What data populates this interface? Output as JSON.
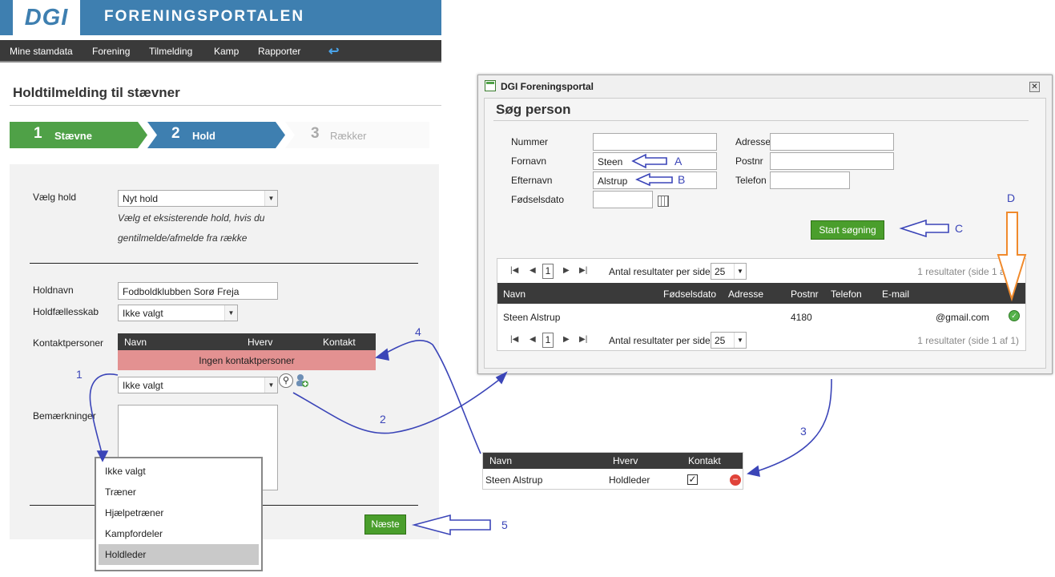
{
  "header": {
    "logo": "DGI",
    "title": "FORENINGSPORTALEN"
  },
  "nav": {
    "items": [
      "Mine stamdata",
      "Forening",
      "Tilmelding",
      "Kamp",
      "Rapporter"
    ],
    "back_icon": "undo-arrow-icon"
  },
  "page": {
    "title": "Holdtilmelding til stævner"
  },
  "steps": [
    {
      "num": "1",
      "label": "Stævne"
    },
    {
      "num": "2",
      "label": "Hold"
    },
    {
      "num": "3",
      "label": "Rækker"
    }
  ],
  "form": {
    "vaelg_hold_label": "Vælg hold",
    "vaelg_hold_value": "Nyt hold",
    "hint_line1": "Vælg et eksisterende hold, hvis du",
    "hint_line2": "gentilmelde/afmelde fra række",
    "holdnavn_label": "Holdnavn",
    "holdnavn_value": "Fodboldklubben Sorø Freja",
    "holdfaellesskab_label": "Holdfællesskab",
    "holdfaellesskab_value": "Ikke valgt",
    "kontakt_label": "Kontaktpersoner",
    "contact_table": {
      "headers": [
        "Navn",
        "Hverv",
        "Kontakt"
      ],
      "empty_text": "Ingen kontaktpersoner"
    },
    "role_select_value": "Ikke valgt",
    "bemaerkninger_label": "Bemærkninger",
    "next_button": "Næste"
  },
  "dropdown": {
    "options": [
      "Ikke valgt",
      "Træner",
      "Hjælpetræner",
      "Kampfordeler",
      "Holdleder"
    ],
    "selected": "Holdleder"
  },
  "dialog": {
    "title": "DGI Foreningsportal",
    "heading": "Søg person",
    "fields": {
      "nummer": {
        "label": "Nummer",
        "value": ""
      },
      "fornavn": {
        "label": "Fornavn",
        "value": "Steen"
      },
      "efternavn": {
        "label": "Efternavn",
        "value": "Alstrup"
      },
      "foedselsdato": {
        "label": "Fødselsdato",
        "value": ""
      },
      "adresse": {
        "label": "Adresse",
        "value": ""
      },
      "postnr": {
        "label": "Postnr",
        "value": ""
      },
      "telefon": {
        "label": "Telefon",
        "value": ""
      }
    },
    "search_button": "Start søgning",
    "pager": {
      "page": "1",
      "per_page_label": "Antal resultater per side",
      "per_page": "25",
      "info": "1 resultater (side 1 af 1)"
    },
    "results": {
      "headers": [
        "Navn",
        "Fødselsdato",
        "Adresse",
        "Postnr",
        "Telefon",
        "E-mail"
      ],
      "rows": [
        {
          "navn": "Steen Alstrup",
          "foedselsdato": "",
          "adresse": "",
          "postnr": "4180",
          "telefon": "",
          "email": "@gmail.com"
        }
      ]
    }
  },
  "result_table": {
    "headers": [
      "Navn",
      "Hverv",
      "Kontakt"
    ],
    "row": {
      "navn": "Steen Alstrup",
      "hverv": "Holdleder",
      "kontakt_checked": "✓"
    }
  },
  "annotations": {
    "A": "A",
    "B": "B",
    "C": "C",
    "D": "D",
    "n1": "1",
    "n2": "2",
    "n3": "3",
    "n4": "4",
    "n5": "5"
  },
  "colors": {
    "brand_blue": "#3e7fb0",
    "step_green": "#4fa147",
    "nav_dark": "#3a3a3a",
    "empty_red": "#e39191",
    "annotation_blue": "#3b45b8",
    "annotation_orange": "#f08a2c"
  }
}
